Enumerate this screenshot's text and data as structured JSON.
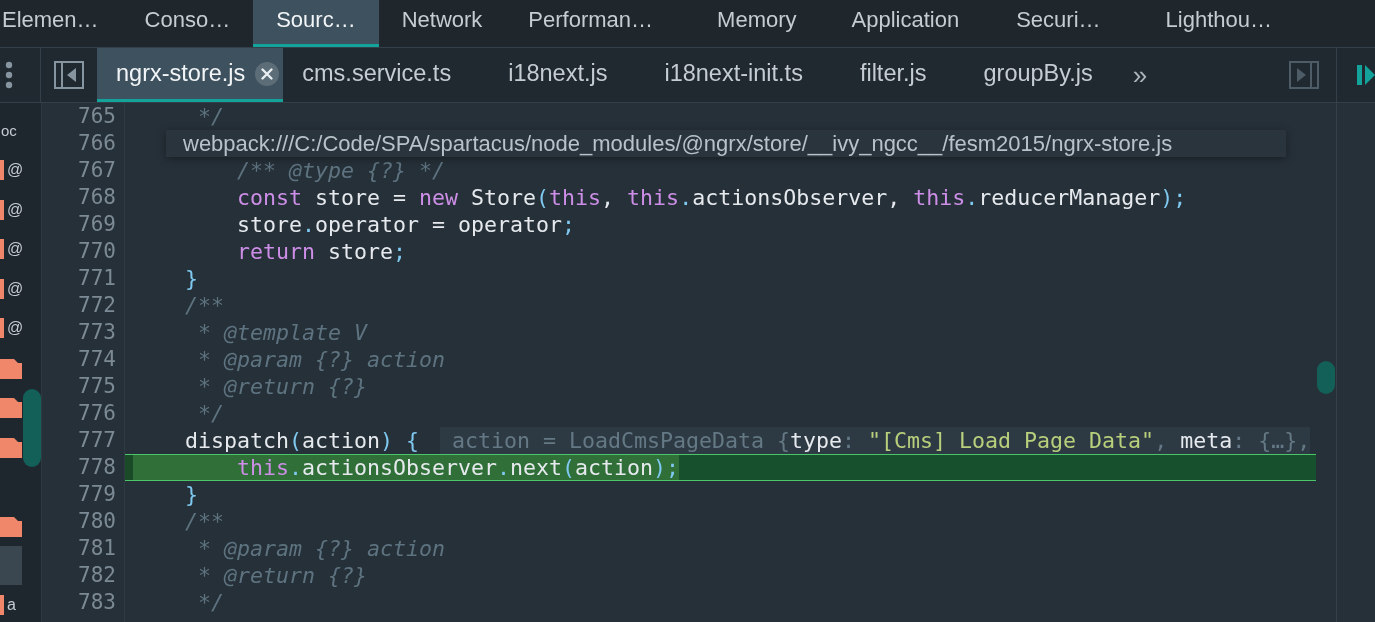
{
  "panel_tabs": [
    {
      "label": "Elemen…",
      "selected": false
    },
    {
      "label": "Conso…",
      "selected": false
    },
    {
      "label": "Sourc…",
      "selected": true
    },
    {
      "label": "Network",
      "selected": false
    },
    {
      "label": "Performan…",
      "selected": false
    },
    {
      "label": "Memory",
      "selected": false
    },
    {
      "label": "Application",
      "selected": false
    },
    {
      "label": "Securi…",
      "selected": false
    },
    {
      "label": "Lighthou…",
      "selected": false
    }
  ],
  "file_tabs": [
    {
      "label": "ngrx-store.js",
      "selected": true
    },
    {
      "label": "cms.service.ts",
      "selected": false
    },
    {
      "label": "i18next.js",
      "selected": false
    },
    {
      "label": "i18next-init.ts",
      "selected": false
    },
    {
      "label": "filter.js",
      "selected": false
    },
    {
      "label": "groupBy.js",
      "selected": false
    }
  ],
  "file_tabs_more": "»",
  "sidebar": {
    "items": [
      {
        "kind": "text",
        "text": "oc",
        "selected": false
      },
      {
        "kind": "scope",
        "text": "@",
        "selected": false
      },
      {
        "kind": "scope",
        "text": "@",
        "selected": false
      },
      {
        "kind": "scope",
        "text": "@",
        "selected": false
      },
      {
        "kind": "scope",
        "text": "@",
        "selected": false
      },
      {
        "kind": "scope",
        "text": "@",
        "selected": false
      },
      {
        "kind": "folder",
        "selected": false
      },
      {
        "kind": "folder",
        "selected": false
      },
      {
        "kind": "folder",
        "selected": false
      },
      {
        "kind": "empty",
        "selected": false
      },
      {
        "kind": "folder",
        "selected": false
      },
      {
        "kind": "empty",
        "selected": true
      },
      {
        "kind": "scope",
        "text": "a",
        "selected": false
      }
    ]
  },
  "tooltip": {
    "text": "webpack:///C:/Code/SPA/spartacus/node_modules/@ngrx/store/__ivy_ngcc__/fesm2015/ngrx-store.js"
  },
  "code": {
    "lines": [
      {
        "number": "765",
        "execution": false,
        "tokens": [
          {
            "kind": "com",
            "text": "     */"
          }
        ]
      },
      {
        "number": "766",
        "execution": false
      },
      {
        "number": "767",
        "execution": false,
        "tokens": [
          {
            "kind": "com",
            "text": "        /** @type {?} */"
          }
        ]
      },
      {
        "number": "768",
        "execution": false,
        "tokens": [
          {
            "kind": "kw",
            "text": "        const"
          },
          {
            "kind": "plain",
            "text": " store = "
          },
          {
            "kind": "kw",
            "text": "new"
          },
          {
            "kind": "plain",
            "text": " Store"
          },
          {
            "kind": "punc",
            "text": "("
          },
          {
            "kind": "kw",
            "text": "this"
          },
          {
            "kind": "plain",
            "text": ", "
          },
          {
            "kind": "kw",
            "text": "this"
          },
          {
            "kind": "punc",
            "text": "."
          },
          {
            "kind": "plain",
            "text": "actionsObserver, "
          },
          {
            "kind": "kw",
            "text": "this"
          },
          {
            "kind": "punc",
            "text": "."
          },
          {
            "kind": "plain",
            "text": "reducerManager"
          },
          {
            "kind": "punc",
            "text": ");"
          }
        ]
      },
      {
        "number": "769",
        "execution": false,
        "tokens": [
          {
            "kind": "plain",
            "text": "        store"
          },
          {
            "kind": "punc",
            "text": "."
          },
          {
            "kind": "plain",
            "text": "operator = operator"
          },
          {
            "kind": "punc",
            "text": ";"
          }
        ]
      },
      {
        "number": "770",
        "execution": false,
        "tokens": [
          {
            "kind": "kw",
            "text": "        return"
          },
          {
            "kind": "plain",
            "text": " store"
          },
          {
            "kind": "punc",
            "text": ";"
          }
        ]
      },
      {
        "number": "771",
        "execution": false,
        "tokens": [
          {
            "kind": "punc",
            "text": "    }"
          }
        ]
      },
      {
        "number": "772",
        "execution": false,
        "tokens": [
          {
            "kind": "com",
            "text": "    /**"
          }
        ]
      },
      {
        "number": "773",
        "execution": false,
        "tokens": [
          {
            "kind": "com",
            "text": "     * @template V"
          }
        ]
      },
      {
        "number": "774",
        "execution": false,
        "tokens": [
          {
            "kind": "com",
            "text": "     * @param {?} action"
          }
        ]
      },
      {
        "number": "775",
        "execution": false,
        "tokens": [
          {
            "kind": "com",
            "text": "     * @return {?}"
          }
        ]
      },
      {
        "number": "776",
        "execution": false,
        "tokens": [
          {
            "kind": "com",
            "text": "     */"
          }
        ]
      },
      {
        "number": "777",
        "execution": false,
        "tokens": [
          {
            "kind": "plain",
            "text": "    dispatch"
          },
          {
            "kind": "punc",
            "text": "("
          },
          {
            "kind": "plain",
            "text": "action"
          },
          {
            "kind": "punc",
            "text": ") {"
          }
        ],
        "inline_value": [
          {
            "kind": "dim",
            "text": "action = LoadCmsPageData {"
          },
          {
            "kind": "plain",
            "text": "type"
          },
          {
            "kind": "dim",
            "text": ": "
          },
          {
            "kind": "str",
            "text": "\"[Cms] Load Page Data\""
          },
          {
            "kind": "dim",
            "text": ", "
          },
          {
            "kind": "plain",
            "text": "meta"
          },
          {
            "kind": "dim",
            "text": ": {…},"
          }
        ]
      },
      {
        "number": "778",
        "execution": true,
        "tokens": [
          {
            "kind": "kw",
            "text": "        this"
          },
          {
            "kind": "punc",
            "text": "."
          },
          {
            "kind": "plain",
            "text": "actionsObserver"
          },
          {
            "kind": "punc",
            "text": "."
          },
          {
            "kind": "plain",
            "text": "next"
          },
          {
            "kind": "punc",
            "text": "("
          },
          {
            "kind": "plain",
            "text": "action"
          },
          {
            "kind": "punc",
            "text": ");"
          }
        ]
      },
      {
        "number": "779",
        "execution": false,
        "tokens": [
          {
            "kind": "punc",
            "text": "    }"
          }
        ]
      },
      {
        "number": "780",
        "execution": false,
        "tokens": [
          {
            "kind": "com",
            "text": "    /**"
          }
        ]
      },
      {
        "number": "781",
        "execution": false,
        "tokens": [
          {
            "kind": "com",
            "text": "     * @param {?} action"
          }
        ]
      },
      {
        "number": "782",
        "execution": false,
        "tokens": [
          {
            "kind": "com",
            "text": "     * @return {?}"
          }
        ]
      },
      {
        "number": "783",
        "execution": false,
        "tokens": [
          {
            "kind": "com",
            "text": "     */"
          }
        ]
      }
    ]
  }
}
